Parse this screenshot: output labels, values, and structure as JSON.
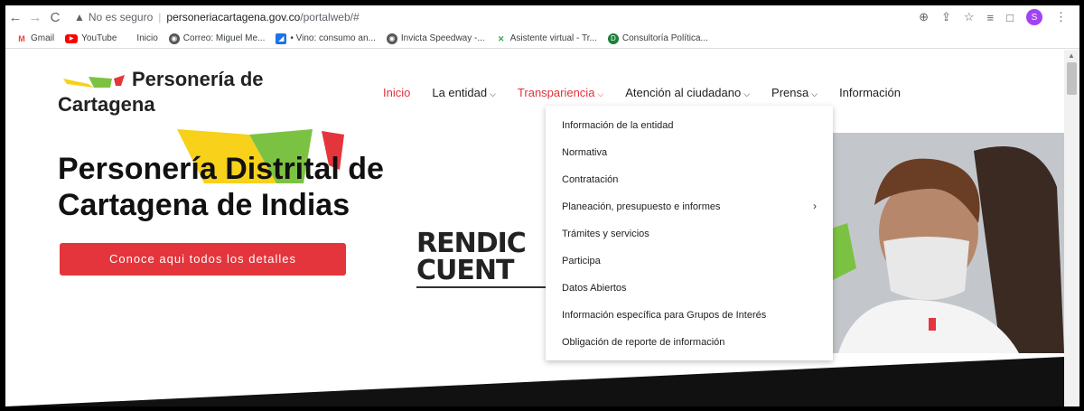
{
  "browser": {
    "security_label": "No es seguro",
    "url_host": "personeriacartagena.gov.co",
    "url_path": "/portalweb/#",
    "profile_initial": "S"
  },
  "bookmarks": [
    {
      "label": "Gmail",
      "icon": "gmail-icon",
      "color": "#ea4335"
    },
    {
      "label": "YouTube",
      "icon": "youtube-icon",
      "color": "#ff0000"
    },
    {
      "label": "Inicio",
      "icon": "",
      "color": ""
    },
    {
      "label": "Correo: Miguel Me...",
      "icon": "globe-icon",
      "color": "#555555"
    },
    {
      "label": "• Vino: consumo an...",
      "icon": "bookmark-icon",
      "color": "#1a73e8"
    },
    {
      "label": "Invicta Speedway -...",
      "icon": "globe-icon",
      "color": "#555555"
    },
    {
      "label": "Asistente virtual - Tr...",
      "icon": "assistant-icon",
      "color": "#34a853"
    },
    {
      "label": "Consultoría Política...",
      "icon": "consult-icon",
      "color": "#188038"
    }
  ],
  "site": {
    "logo_line1": "Personería de",
    "logo_line2": "Cartagena",
    "nav": [
      {
        "label": "Inicio",
        "has_menu": false,
        "active": true
      },
      {
        "label": "La entidad",
        "has_menu": true,
        "active": false
      },
      {
        "label": "Transpariencia",
        "has_menu": true,
        "active": true
      },
      {
        "label": "Atención al ciudadano",
        "has_menu": true,
        "active": false
      },
      {
        "label": "Prensa",
        "has_menu": true,
        "active": false
      },
      {
        "label": "Información",
        "has_menu": false,
        "active": false
      }
    ],
    "hero_line1": "Personería Distrital de",
    "hero_line2": "Cartagena de Indias",
    "cta": "Conoce aqui todos los detalles",
    "rendicion_line1": "RENDIC",
    "rendicion_line2": "CUENT"
  },
  "dropdown": [
    "Información de la entidad",
    "Normativa",
    "Contratación",
    "Planeación, presupuesto e informes",
    "Trámites y servicios",
    "Participa",
    "Datos Abiertos",
    "Información específica para Grupos de Interés",
    "Obligación de reporte de información"
  ],
  "colors": {
    "accent_red": "#e4353c",
    "logo_yellow": "#f7d11a",
    "logo_green": "#7cc242"
  }
}
